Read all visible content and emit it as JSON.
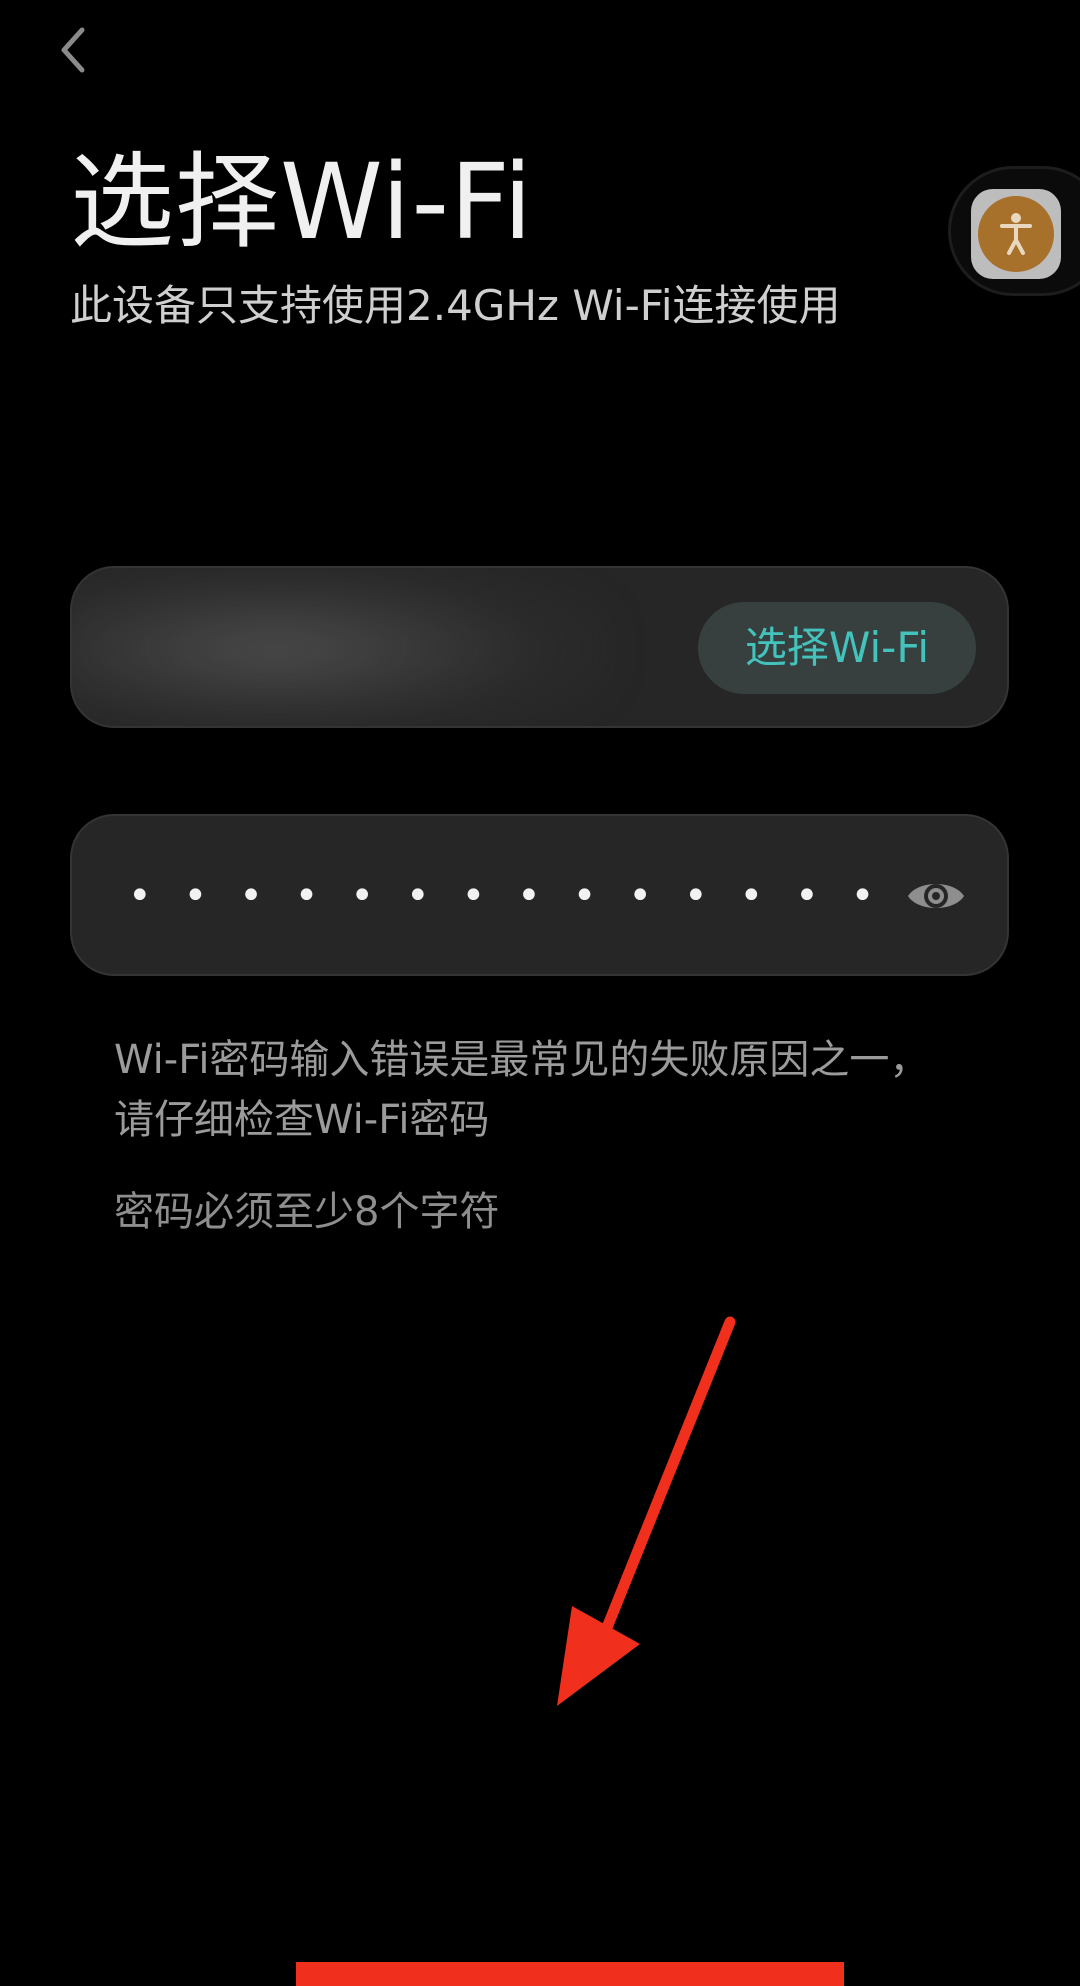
{
  "header": {
    "back_icon": "chevron-left-icon",
    "title": "选择Wi-Fi",
    "subtitle": "此设备只支持使用2.4GHz Wi-Fi连接使用"
  },
  "floating_accessibility": {
    "icon": "accessibility-person-icon",
    "colors": {
      "outer": "#bdbdbd",
      "inner": "#a8712b"
    }
  },
  "wifi_select": {
    "network_name": "",
    "network_name_blurred": true,
    "choose_button_label": "选择Wi-Fi",
    "button_text_color": "#44c3bd"
  },
  "password": {
    "masked_value": "••••••••••••••",
    "visibility_icon": "eye-icon"
  },
  "hints": {
    "error_hint": "Wi-Fi密码输入错误是最常见的失败原因之一，请仔细检查Wi-Fi密码",
    "min_length": "密码必须至少8个字符"
  },
  "annotation": {
    "arrow_icon": "red-arrow-down-left-icon",
    "arrow_color": "#f0301c"
  }
}
